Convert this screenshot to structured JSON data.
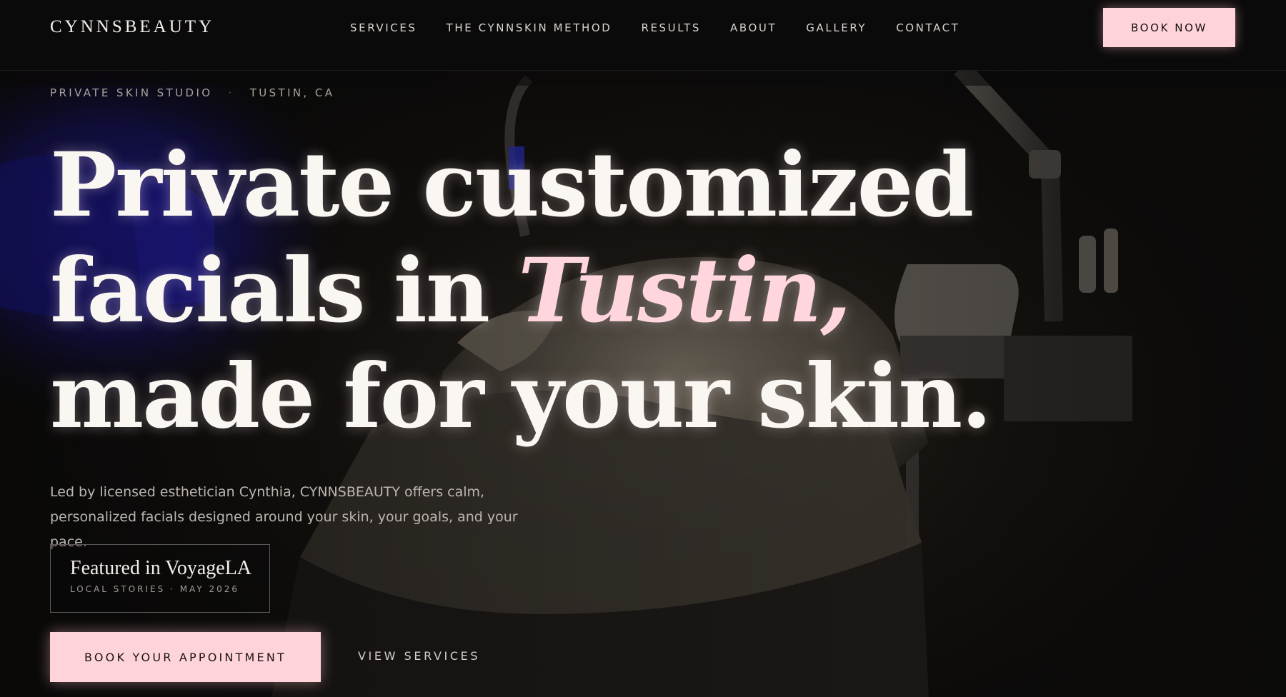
{
  "header": {
    "logo": "CYNNSBEAUTY",
    "nav": [
      "SERVICES",
      "THE CYNNSKIN METHOD",
      "RESULTS",
      "ABOUT",
      "GALLERY",
      "CONTACT"
    ],
    "book_now_label": "BOOK NOW"
  },
  "hero": {
    "eyebrow_left": "PRIVATE SKIN STUDIO",
    "eyebrow_separator": "·",
    "eyebrow_right": "TUSTIN, CA",
    "headline_line1": "Private customized",
    "headline_line2_prefix": "facials in ",
    "headline_line2_accent": "Tustin,",
    "headline_line3": "made for your skin.",
    "lede_line1": "Led by licensed esthetician Cynthia, CYNNSBEAUTY offers calm,",
    "lede_line2": "personalized facials designed around your skin, your goals, and your pace.",
    "featured_title": "Featured in VoyageLA",
    "featured_sub": "LOCAL STORIES · MAY 2026",
    "cta_primary_label": "BOOK YOUR APPOINTMENT",
    "cta_secondary_label": "VIEW SERVICES"
  },
  "colors": {
    "background": "#0b0a0a",
    "accent_pink": "#ffd3da",
    "text_light": "#faf6f2",
    "text_muted": "#bcb5b0"
  }
}
